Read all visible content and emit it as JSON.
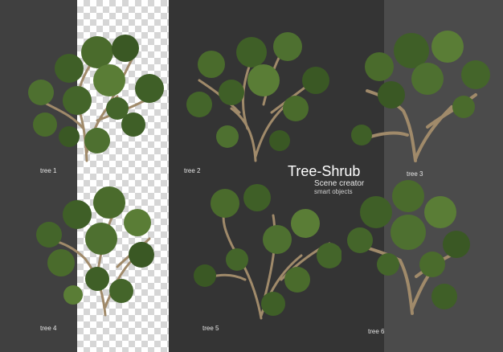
{
  "headline": {
    "title": "Tree-Shrub",
    "subtitle": "Scene creator",
    "tagline": "smart objects"
  },
  "trees": [
    {
      "label": "tree 1"
    },
    {
      "label": "tree 2"
    },
    {
      "label": "tree 3"
    },
    {
      "label": "tree 4"
    },
    {
      "label": "tree 5"
    },
    {
      "label": "tree 6"
    }
  ],
  "colors": {
    "foliage_dark": "#2f4a1e",
    "foliage_mid": "#4a6b2c",
    "foliage_light": "#6e8f3e",
    "trunk": "#a08a6a",
    "checker": "#d6d6d6"
  }
}
